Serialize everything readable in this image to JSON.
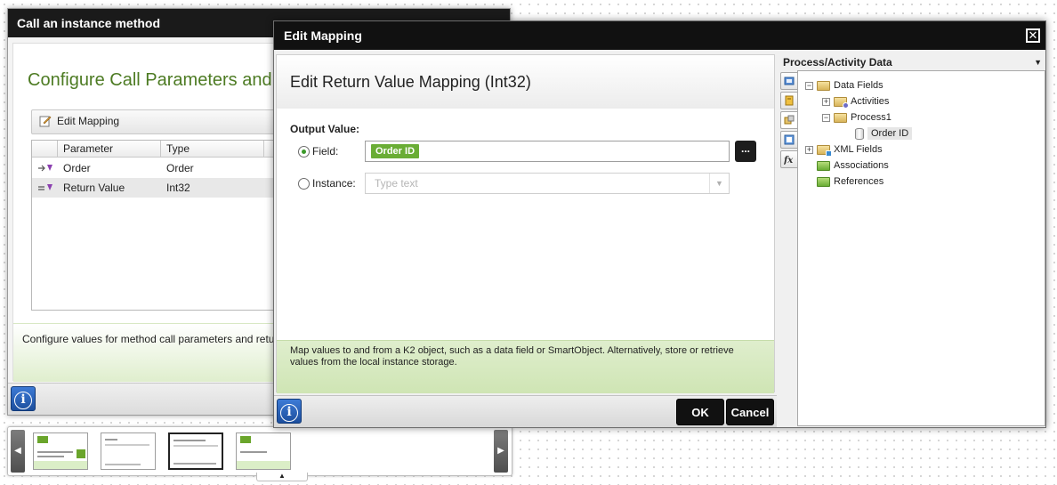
{
  "background_dialog": {
    "title": "Call an instance method",
    "heading": "Configure Call Parameters and",
    "toolbar": {
      "edit_mapping_label": "Edit Mapping"
    },
    "grid": {
      "columns": [
        "Parameter",
        "Type"
      ],
      "rows": [
        {
          "parameter": "Order",
          "type": "Order"
        },
        {
          "parameter": "Return Value",
          "type": "Int32"
        }
      ]
    },
    "footer_note": "Configure values for method call parameters and return va"
  },
  "edit_mapping_dialog": {
    "title": "Edit Mapping",
    "heading": "Edit Return Value Mapping (Int32)",
    "output_label": "Output Value:",
    "field_option_label": "Field:",
    "field_value": "Order ID",
    "browse_label": "...",
    "instance_option_label": "Instance:",
    "instance_placeholder": "Type text",
    "note": "Map values to and from a K2 object, such as a data field or SmartObject. Alternatively, store or retrieve values from the local instance storage.",
    "ok_label": "OK",
    "cancel_label": "Cancel",
    "selected_option": "field"
  },
  "data_panel": {
    "title": "Process/Activity Data",
    "tree": [
      {
        "label": "Data Fields",
        "expander": "−"
      },
      {
        "label": "Activities",
        "expander": "+"
      },
      {
        "label": "Process1",
        "expander": "−"
      },
      {
        "label": "Order ID",
        "selected": true
      },
      {
        "label": "XML Fields",
        "expander": "+"
      },
      {
        "label": "Associations"
      },
      {
        "label": "References"
      }
    ]
  },
  "colors": {
    "accent_green": "#6aad35",
    "heading_green": "#4d7b23",
    "title_bar": "#111111"
  }
}
